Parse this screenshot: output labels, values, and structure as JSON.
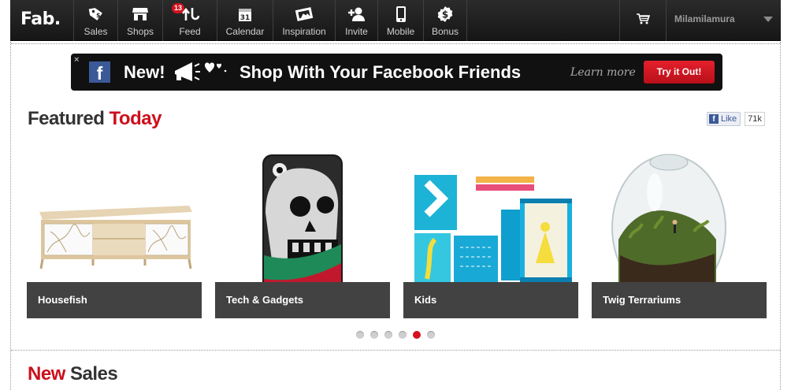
{
  "nav": {
    "logo": "Fab.",
    "items": [
      {
        "label": "Sales",
        "icon": "tag-icon"
      },
      {
        "label": "Shops",
        "icon": "shop-icon"
      },
      {
        "label": "Feed",
        "icon": "feed-icon",
        "badge": "13"
      },
      {
        "label": "Calendar",
        "icon": "calendar-icon",
        "icon_text": "31"
      },
      {
        "label": "Inspiration",
        "icon": "inspiration-icon"
      },
      {
        "label": "Invite",
        "icon": "invite-icon"
      },
      {
        "label": "Mobile",
        "icon": "mobile-icon"
      },
      {
        "label": "Bonus",
        "icon": "bonus-icon",
        "icon_text": "$"
      }
    ],
    "cart_icon": "cart-icon",
    "username": "Milamilamura"
  },
  "banner": {
    "close": "×",
    "fb_letter": "f",
    "new_text": "New!",
    "headline": "Shop With Your Facebook Friends",
    "learn_more": "Learn more",
    "cta": "Try it Out!"
  },
  "featured": {
    "title_part1": "Featured",
    "title_part2": "Today",
    "like_label": "Like",
    "like_count": "71k",
    "cards": [
      {
        "label": "Housefish"
      },
      {
        "label": "Tech & Gadgets"
      },
      {
        "label": "Kids"
      },
      {
        "label": "Twig Terrariums"
      }
    ],
    "prev": "‹",
    "next": "›",
    "dots_total": 6,
    "dot_active_index": 4
  },
  "new_sales": {
    "title_part1": "New",
    "title_part2": "Sales"
  },
  "colors": {
    "accent_red": "#cc0f1c",
    "nav_bg": "#1b1b1b",
    "facebook_blue": "#3b5998"
  }
}
